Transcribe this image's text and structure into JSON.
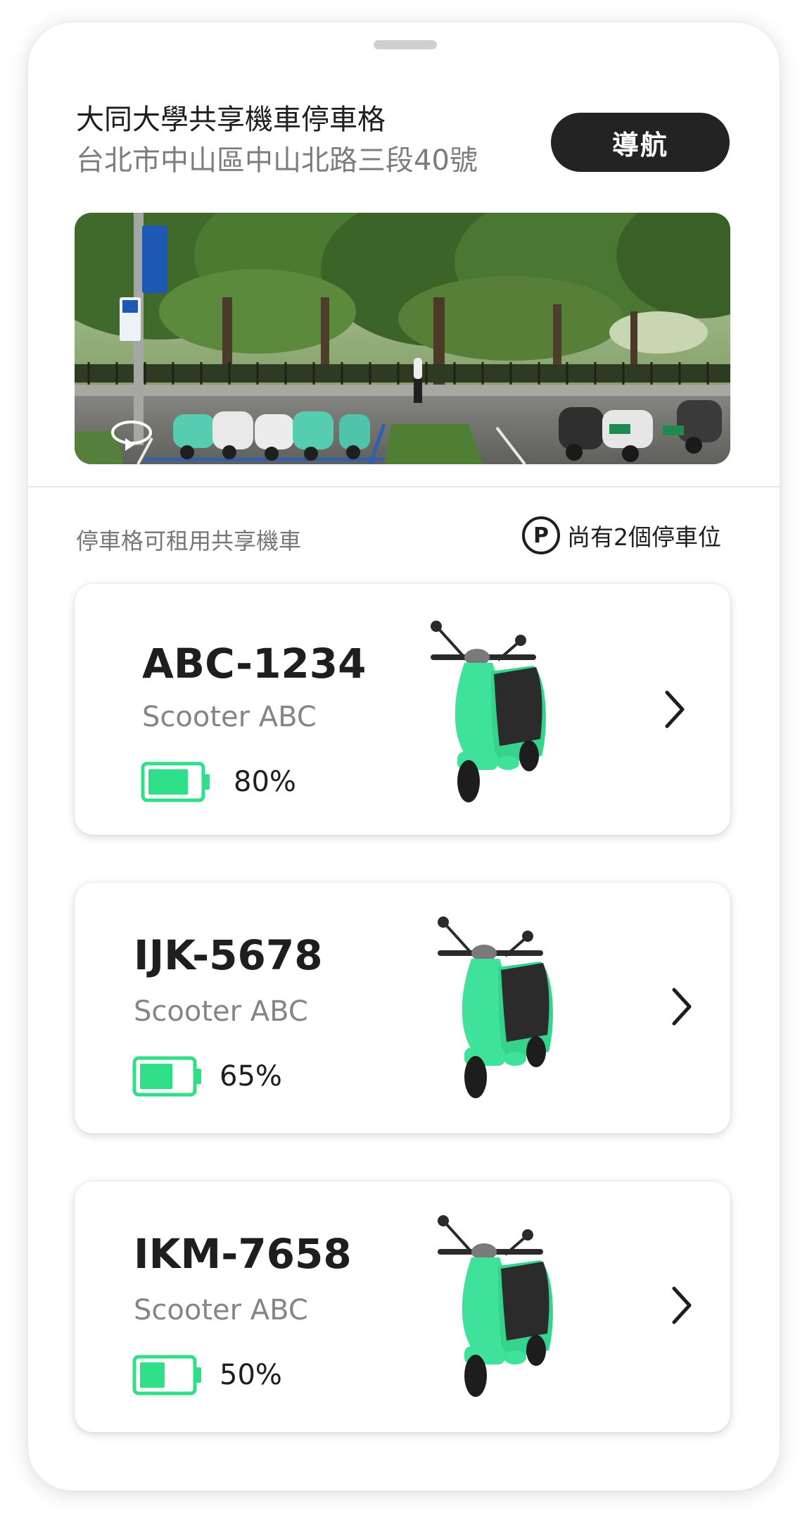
{
  "header": {
    "place_name": "大同大學共享機車停車格",
    "address": "台北市中山區中山北路三段40號",
    "navigate_label": "導航"
  },
  "section": {
    "label": "停車格可租用共享機車",
    "parking_badge": "P",
    "parking_text": "尚有2個停車位"
  },
  "colors": {
    "accent_green": "#2fe089",
    "scooter_green": "#3ee29a",
    "dark_button": "#232323"
  },
  "scooters": [
    {
      "plate": "ABC-1234",
      "model": "Scooter ABC",
      "battery_label": "80%",
      "battery_level": 0.8
    },
    {
      "plate": "IJK-5678",
      "model": "Scooter ABC",
      "battery_label": "65%",
      "battery_level": 0.65
    },
    {
      "plate": "IKM-7658",
      "model": "Scooter ABC",
      "battery_label": "50%",
      "battery_level": 0.5
    }
  ]
}
